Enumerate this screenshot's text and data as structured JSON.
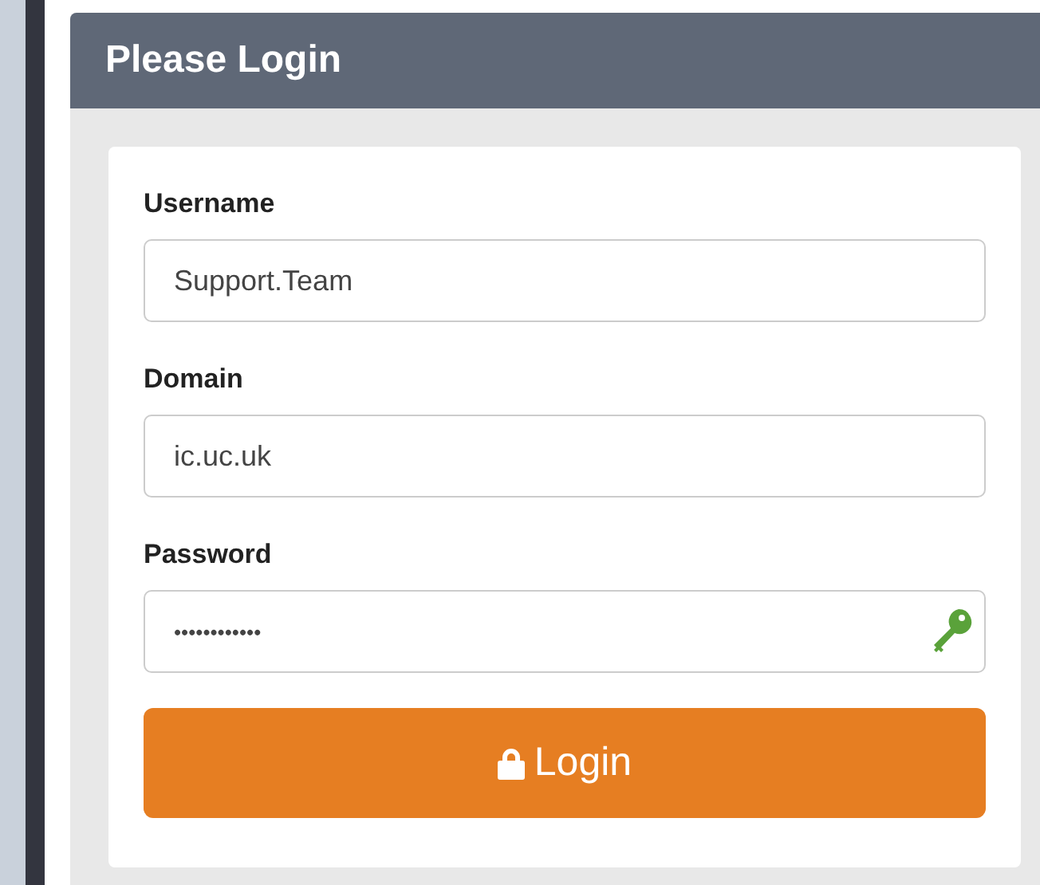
{
  "panel": {
    "title": "Please Login"
  },
  "fields": [
    {
      "label": "Username",
      "value": "Support.Team",
      "kind": "text"
    },
    {
      "label": "Domain",
      "value": "ic.uc.uk",
      "kind": "text"
    },
    {
      "label": "Password",
      "value": "••••••••••••",
      "kind": "password"
    }
  ],
  "button": {
    "label": "Login"
  }
}
